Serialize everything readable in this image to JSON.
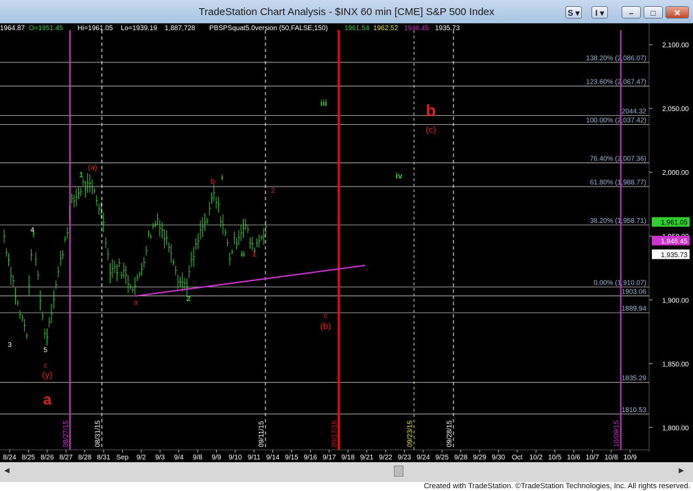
{
  "window": {
    "title": "TradeStation Chart Analysis - $INX 60 min [CME] S&P 500 Index",
    "buttons": {
      "s_label": "S",
      "i_label": "I"
    }
  },
  "colors": {
    "background": "#000000",
    "price_bars": "#33cc33",
    "fib_lines": "#c8c8c8",
    "trend_line": "#cc33cc",
    "wave_red": "#dd2222",
    "wave_green": "#33cc33",
    "date_marker": "#ffffff",
    "date_marker_magenta": "#cc33cc",
    "date_marker_red": "#e01010",
    "date_marker_yellow": "#e6e64d"
  },
  "status_line": {
    "last": "1964.87",
    "open": "O=1951.45",
    "high": "Hi=1961.05",
    "low": "Lo=1939.19",
    "volume": "1,887,728",
    "study": "PBSPSquat5.0version (50,FALSE,150)",
    "v1": "1961.54",
    "v2": "1962.52",
    "v3": "1946.45",
    "v4": "1935.73"
  },
  "fib_levels": [
    {
      "label": "138.20% (2,086.07)",
      "value": 2086.07
    },
    {
      "label": "123.60% (2,067.47)",
      "value": 2067.47
    },
    {
      "label": "2044.32",
      "value": 2044.32
    },
    {
      "label": "100.00% (2,037.42)",
      "value": 2037.42
    },
    {
      "label": "76.40% (2,007.36)",
      "value": 2007.36
    },
    {
      "label": "61.80% (1,988.77)",
      "value": 1988.77
    },
    {
      "label": "38.20% (1,958.71)",
      "value": 1958.71
    },
    {
      "label": "0.00% (1,910.07)",
      "value": 1910.07
    },
    {
      "label": "1903.06",
      "value": 1903.06
    },
    {
      "label": "1889.94",
      "value": 1889.94
    },
    {
      "label": "1835.29",
      "value": 1835.29
    },
    {
      "label": "1810.53",
      "value": 1810.53
    }
  ],
  "price_tags": [
    {
      "label": "1,961.05",
      "value": 1961.05,
      "bg": "#33cc33",
      "fg": "#000000"
    },
    {
      "label": "1,946.45",
      "value": 1946.45,
      "bg": "#cc33cc",
      "fg": "#ffffff"
    },
    {
      "label": "1,935.73",
      "value": 1935.73,
      "bg": "#ffffff",
      "fg": "#000000"
    }
  ],
  "y_axis": {
    "ticks": [
      "1,800.00",
      "1,850.00",
      "1,900.00",
      "1,950.00",
      "2,000.00",
      "2,050.00",
      "2,100.00"
    ],
    "values": [
      1800,
      1850,
      1900,
      1950,
      2000,
      2050,
      2100
    ],
    "ylim": [
      1790,
      2107
    ]
  },
  "x_axis": {
    "labels": [
      "8/24",
      "8/25",
      "8/26",
      "8/27",
      "8/28",
      "8/31",
      "Sep",
      "9/2",
      "9/3",
      "9/4",
      "9/8",
      "9/9",
      "9/10",
      "9/11",
      "9/14",
      "9/15",
      "9/16",
      "9/17",
      "9/18",
      "9/21",
      "9/22",
      "9/23",
      "9/24",
      "9/25",
      "9/28",
      "9/29",
      "9/30",
      "Oct",
      "10/2",
      "10/5",
      "10/6",
      "10/7",
      "10/8",
      "10/9"
    ]
  },
  "date_markers": [
    {
      "label": "08/27/15",
      "style": "magenta",
      "slot": 3.5
    },
    {
      "label": "08/31/15",
      "style": "white",
      "slot": 5.2
    },
    {
      "label": "09/11/15",
      "style": "white",
      "slot": 13.9
    },
    {
      "label": "09/17/15",
      "style": "red",
      "slot": 17.8
    },
    {
      "label": "09/23/15",
      "style": "yellow",
      "slot": 21.8
    },
    {
      "label": "09/28/15",
      "style": "white",
      "slot": 23.9
    },
    {
      "label": "10/09/15",
      "style": "magenta",
      "slot": 32.8
    }
  ],
  "trend_line": {
    "start": {
      "slot": 7.0,
      "value": 1903
    },
    "end": {
      "slot": 19.2,
      "value": 1927
    }
  },
  "wave_labels": [
    {
      "text": "3",
      "color": "white",
      "slot": 0.3,
      "value": 1863,
      "size": 10
    },
    {
      "text": "4",
      "color": "white",
      "slot": 1.5,
      "value": 1953,
      "size": 10
    },
    {
      "text": "5",
      "color": "white",
      "slot": 2.2,
      "value": 1859,
      "size": 10
    },
    {
      "text": "c",
      "color": "red",
      "slot": 2.2,
      "value": 1847,
      "size": 10
    },
    {
      "text": "(y)",
      "color": "red",
      "slot": 2.3,
      "value": 1839,
      "size": 13
    },
    {
      "text": "a",
      "color": "red",
      "slot": 2.3,
      "value": 1818,
      "size": 22,
      "bold": true
    },
    {
      "text": "1",
      "color": "green",
      "slot": 4.1,
      "value": 1996,
      "size": 11,
      "bold": true
    },
    {
      "text": "(a)",
      "color": "red",
      "slot": 4.7,
      "value": 2002,
      "size": 11
    },
    {
      "text": "a",
      "color": "red",
      "slot": 7.0,
      "value": 1896,
      "size": 11
    },
    {
      "text": "2",
      "color": "green",
      "slot": 9.8,
      "value": 1899,
      "size": 11,
      "bold": true
    },
    {
      "text": "b",
      "color": "red",
      "slot": 11.1,
      "value": 1991,
      "size": 11
    },
    {
      "text": "i",
      "color": "green",
      "slot": 11.6,
      "value": 1994,
      "size": 11,
      "bold": true
    },
    {
      "text": "ii",
      "color": "green",
      "slot": 12.7,
      "value": 1934,
      "size": 11,
      "bold": true
    },
    {
      "text": "1",
      "color": "red",
      "slot": 13.3,
      "value": 1934,
      "size": 11
    },
    {
      "text": "2",
      "color": "red",
      "slot": 14.3,
      "value": 1984,
      "size": 10
    },
    {
      "text": "iii",
      "color": "green",
      "slot": 17.0,
      "value": 2052,
      "size": 12,
      "bold": true
    },
    {
      "text": "c",
      "color": "red",
      "slot": 17.1,
      "value": 1886,
      "size": 11
    },
    {
      "text": "(b)",
      "color": "red",
      "slot": 17.1,
      "value": 1877,
      "size": 13
    },
    {
      "text": "iv",
      "color": "green",
      "slot": 21.0,
      "value": 1995,
      "size": 12,
      "bold": true
    },
    {
      "text": "b",
      "color": "red",
      "slot": 22.7,
      "value": 2044,
      "size": 24,
      "bold": true
    },
    {
      "text": "(c)",
      "color": "red",
      "slot": 22.7,
      "value": 2031,
      "size": 13
    }
  ],
  "bars_seed": [
    {
      "slot": 0.0,
      "value": 1950
    },
    {
      "slot": 0.8,
      "value": 1890
    },
    {
      "slot": 1.2,
      "value": 1875
    },
    {
      "slot": 1.5,
      "value": 1955
    },
    {
      "slot": 2.2,
      "value": 1868
    },
    {
      "slot": 2.6,
      "value": 1900
    },
    {
      "slot": 3.0,
      "value": 1930
    },
    {
      "slot": 3.6,
      "value": 1975
    },
    {
      "slot": 4.2,
      "value": 1990
    },
    {
      "slot": 4.8,
      "value": 1985
    },
    {
      "slot": 5.3,
      "value": 1962
    },
    {
      "slot": 5.6,
      "value": 1925
    },
    {
      "slot": 6.2,
      "value": 1925
    },
    {
      "slot": 6.6,
      "value": 1915
    },
    {
      "slot": 7.0,
      "value": 1910
    },
    {
      "slot": 7.3,
      "value": 1925
    },
    {
      "slot": 7.7,
      "value": 1950
    },
    {
      "slot": 8.2,
      "value": 1965
    },
    {
      "slot": 8.5,
      "value": 1950
    },
    {
      "slot": 8.9,
      "value": 1940
    },
    {
      "slot": 9.3,
      "value": 1915
    },
    {
      "slot": 9.7,
      "value": 1912
    },
    {
      "slot": 10.0,
      "value": 1930
    },
    {
      "slot": 10.5,
      "value": 1955
    },
    {
      "slot": 10.9,
      "value": 1965
    },
    {
      "slot": 11.1,
      "value": 1984
    },
    {
      "slot": 11.6,
      "value": 1962
    },
    {
      "slot": 12.0,
      "value": 1935
    },
    {
      "slot": 12.4,
      "value": 1950
    },
    {
      "slot": 12.8,
      "value": 1960
    },
    {
      "slot": 13.2,
      "value": 1940
    },
    {
      "slot": 13.6,
      "value": 1948
    },
    {
      "slot": 14.0,
      "value": 1960
    }
  ],
  "footer": {
    "credit": "Created with TradeStation. ©TradeStation Technologies, Inc. All rights reserved."
  }
}
